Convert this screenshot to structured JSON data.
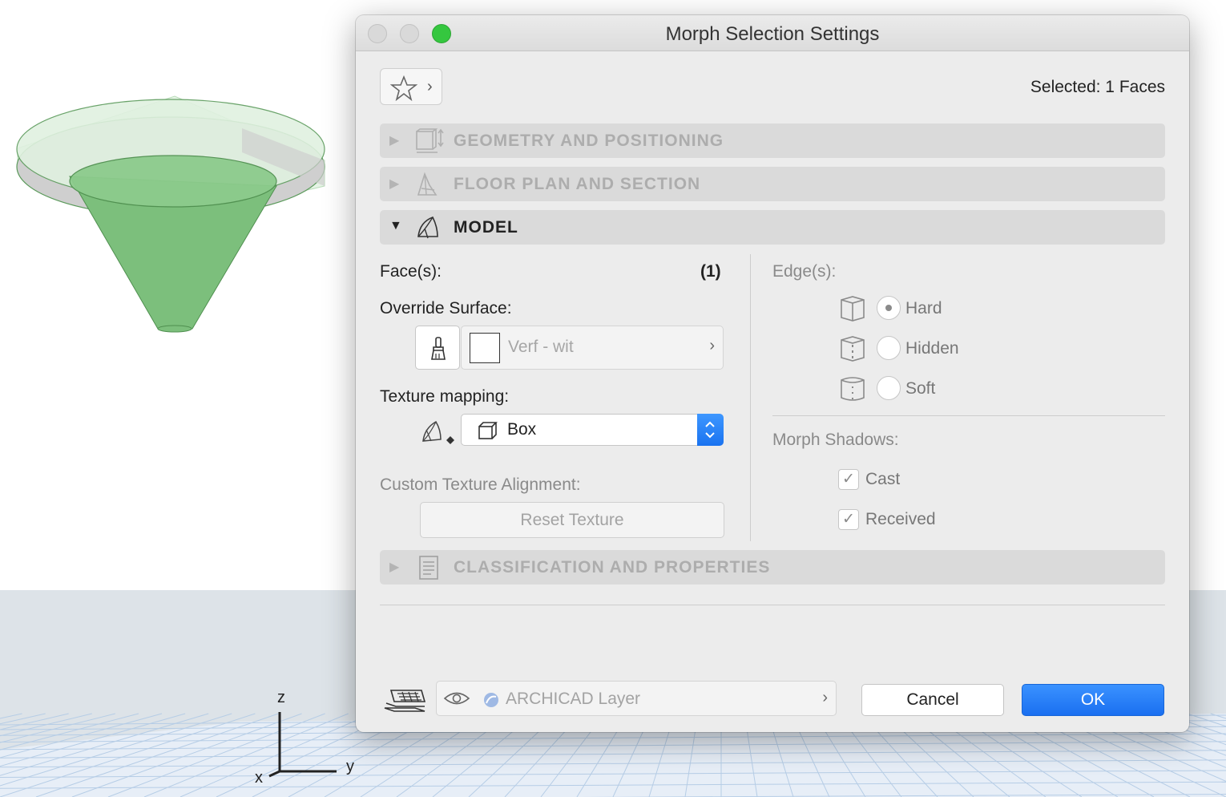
{
  "window": {
    "title": "Morph Selection Settings"
  },
  "header": {
    "selected": "Selected: 1 Faces"
  },
  "sections": {
    "geometry": "GEOMETRY AND POSITIONING",
    "floorplan": "FLOOR PLAN AND SECTION",
    "model": "MODEL",
    "classification": "CLASSIFICATION AND PROPERTIES"
  },
  "model": {
    "faces_label": "Face(s):",
    "faces_count": "(1)",
    "override_label": "Override Surface:",
    "surface_value": "Verf - wit",
    "texture_label": "Texture mapping:",
    "texture_value": "Box",
    "custom_label": "Custom Texture Alignment:",
    "reset_button": "Reset Texture",
    "edges_label": "Edge(s):",
    "edges": [
      {
        "label": "Hard",
        "selected": true
      },
      {
        "label": "Hidden",
        "selected": false
      },
      {
        "label": "Soft",
        "selected": false
      }
    ],
    "shadows_label": "Morph Shadows:",
    "shadows": [
      {
        "label": "Cast",
        "checked": true
      },
      {
        "label": "Received",
        "checked": true
      }
    ]
  },
  "footer": {
    "layer_value": "ARCHICAD Layer",
    "cancel": "Cancel",
    "ok": "OK"
  },
  "axes": {
    "z": "z",
    "y": "y",
    "x": "x"
  },
  "colors": {
    "accent": "#1a73f0",
    "traffic_zoom": "#35c73f",
    "morph_green": "#7cbf7c",
    "floor_grid": "#b8cfe8"
  }
}
